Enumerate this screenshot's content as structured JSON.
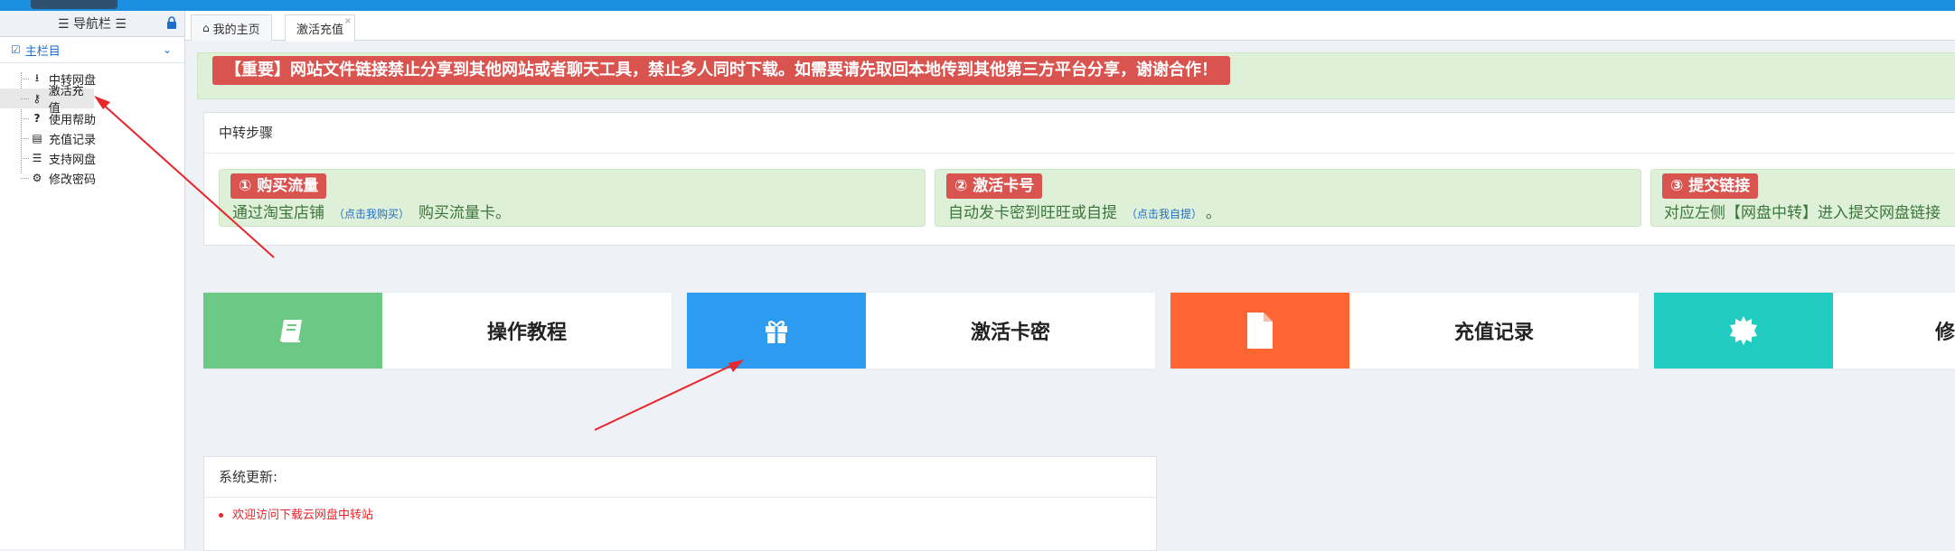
{
  "sidebar": {
    "header": "☰ 导航栏 ☰",
    "section": "主栏目",
    "items": [
      {
        "label": "中转网盘",
        "icon": "download-icon"
      },
      {
        "label": "激活充值",
        "icon": "key-icon"
      },
      {
        "label": "使用帮助",
        "icon": "question-icon"
      },
      {
        "label": "充值记录",
        "icon": "book-icon"
      },
      {
        "label": "支持网盘",
        "icon": "list-icon"
      },
      {
        "label": "修改密码",
        "icon": "gear-icon"
      }
    ]
  },
  "tabs": [
    {
      "label": "我的主页"
    },
    {
      "label": "激活充值"
    }
  ],
  "notice": {
    "text": "【重要】网站文件链接禁止分享到其他网站或者聊天工具，禁止多人同时下载。如需要请先取回本地传到其他第三方平台分享，谢谢合作！"
  },
  "steps": {
    "title": "中转步骤",
    "items": [
      {
        "badge": "① 购买流量",
        "text_before": "通过淘宝店铺",
        "link": "（点击我购买）",
        "text_after": "购买流量卡。"
      },
      {
        "badge": "② 激活卡号",
        "text_before": "自动发卡密到旺旺或自提",
        "link": "（点击我自提）",
        "text_after": "。"
      },
      {
        "badge": "③ 提交链接",
        "text_before": "对应左侧【网盘中转】进入提交网盘链接",
        "link": "",
        "text_after": ""
      }
    ]
  },
  "tiles": [
    {
      "label": "操作教程",
      "icon": "book-icon",
      "color": "#6cc885"
    },
    {
      "label": "激活卡密",
      "icon": "gift-icon",
      "color": "#2d9cf0"
    },
    {
      "label": "充值记录",
      "icon": "file-icon",
      "color": "#ff6533"
    },
    {
      "label": "修",
      "icon": "gear-badge-icon",
      "color": "#22ccc1"
    }
  ],
  "updates": {
    "title": "系统更新:",
    "items": [
      "欢迎访问下载云网盘中转站"
    ]
  },
  "colors": {
    "topbar": "#1a8fe0",
    "accent_red": "#d9534f",
    "notice_bg": "#dff0d8",
    "annotation_arrow": "#e8262b"
  }
}
